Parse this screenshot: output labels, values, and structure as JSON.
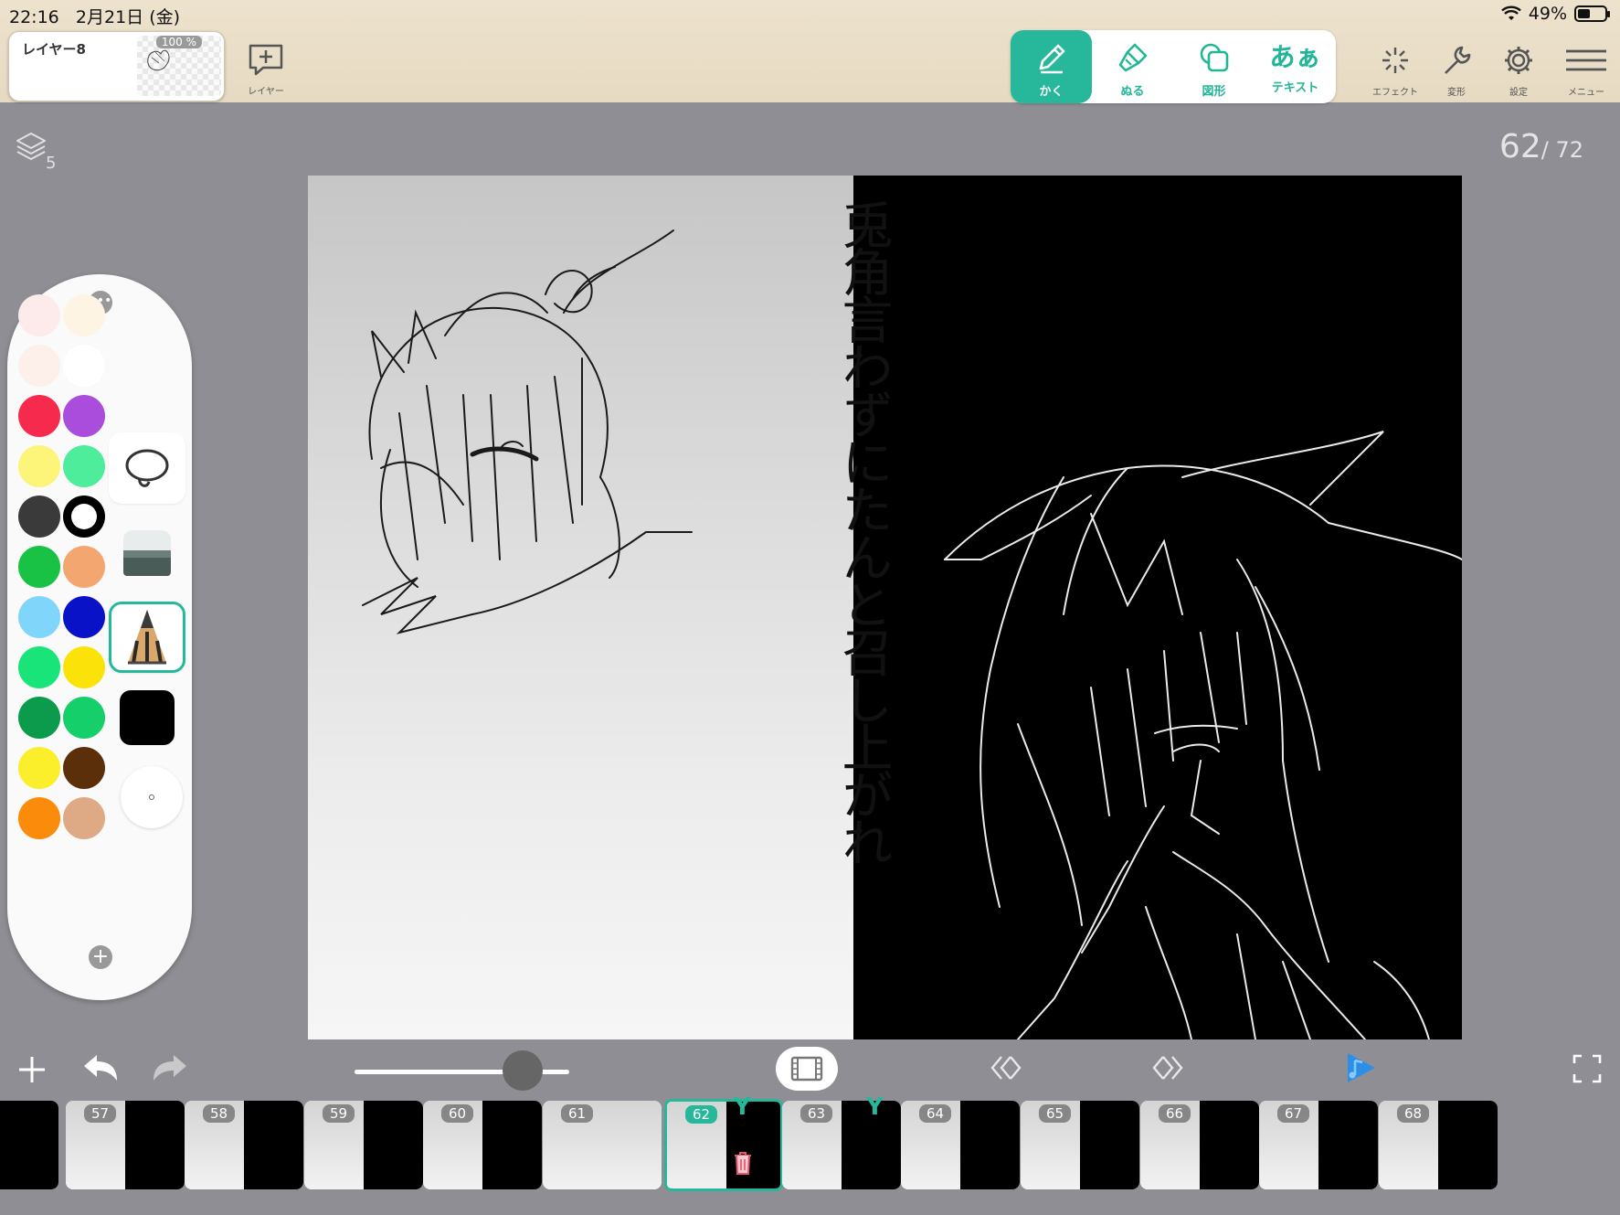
{
  "status_bar": {
    "time": "22:16",
    "date": "2月21日 (金)",
    "battery": "49%"
  },
  "layer_chip": {
    "name": "レイヤー8",
    "opacity": "100 %"
  },
  "top_actions": {
    "add_layer_label": "レイヤー"
  },
  "tools": [
    {
      "id": "draw",
      "label": "かく",
      "icon": "pencil-icon",
      "active": true
    },
    {
      "id": "fill",
      "label": "ぬる",
      "icon": "paint-brush-icon",
      "active": false
    },
    {
      "id": "shape",
      "label": "図形",
      "icon": "shapes-icon",
      "active": false
    },
    {
      "id": "text",
      "label": "テキスト",
      "glyph": "あぁ",
      "icon": "text-icon",
      "active": false
    }
  ],
  "right_tools": {
    "effect": "エフェクト",
    "transform": "変形",
    "settings": "設定",
    "menu": "メニュー"
  },
  "canvas": {
    "layers_count": "5",
    "current_frame": "62",
    "total_frames": "/ 72",
    "vertical_text": "兎角言わずにたんと召し上がれ"
  },
  "palette": {
    "colors": [
      "#fdeaea",
      "#fef4e3",
      "#fdf0ea",
      "#ffffff",
      "#f62a4d",
      "#aa4ddc",
      "#fcf57a",
      "#4ded9b",
      "#3a3a3a",
      "#000000",
      "#19c244",
      "#f4a670",
      "#7fd5fa",
      "#0a12c8",
      "#19e47a",
      "#fbe30a",
      "#0c9b4c",
      "#15cf6a",
      "#fbee2a",
      "#5a2f0a",
      "#fb8b0b",
      "#deaa85"
    ],
    "current_color": "#000000",
    "accent": "#27b89b"
  },
  "timeline": {
    "frames": [
      {
        "num": "",
        "kind": "first"
      },
      {
        "num": "57",
        "kind": "split"
      },
      {
        "num": "58",
        "kind": "split"
      },
      {
        "num": "59",
        "kind": "split"
      },
      {
        "num": "60",
        "kind": "split"
      },
      {
        "num": "61",
        "kind": "blank"
      },
      {
        "num": "62",
        "kind": "current"
      },
      {
        "num": "63",
        "kind": "split"
      },
      {
        "num": "64",
        "kind": "split"
      },
      {
        "num": "65",
        "kind": "split"
      },
      {
        "num": "66",
        "kind": "split"
      },
      {
        "num": "67",
        "kind": "split"
      },
      {
        "num": "68",
        "kind": "split"
      }
    ]
  }
}
